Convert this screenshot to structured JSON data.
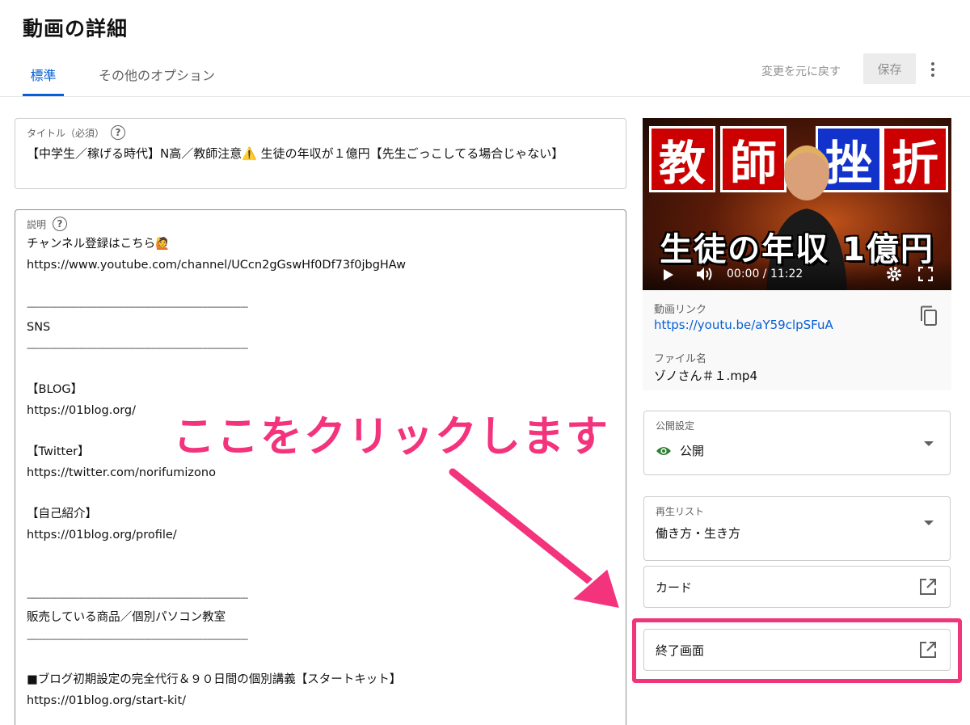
{
  "page": {
    "title": "動画の詳細"
  },
  "tabs": [
    {
      "label": "標準",
      "active": true
    },
    {
      "label": "その他のオプション",
      "active": false
    }
  ],
  "toolbar": {
    "undo_label": "変更を元に戻す",
    "save_label": "保存",
    "more_icon": "more-vert-icon"
  },
  "title_field": {
    "label": "タイトル（必須）",
    "value": "【中学生／稼げる時代】N高／教師注意⚠️ 生徒の年収が１億円【先生ごっこしてる場合じゃない】"
  },
  "description_field": {
    "label": "説明",
    "lines": [
      "チャンネル登録はこちら🙋",
      "https://www.youtube.com/channel/UCcn2gGswHf0Df73f0jbgHAw",
      "",
      "--------------------------------------------------------------------------------------------",
      "SNS",
      "--------------------------------------------------------------------------------------------",
      "",
      "【BLOG】",
      "https://01blog.org/",
      "",
      "【Twitter】",
      "https://twitter.com/norifumizono",
      "",
      "【自己紹介】",
      "https://01blog.org/profile/",
      "",
      "",
      "--------------------------------------------------------------------------------------------",
      "販売している商品／個別パソコン教室",
      "--------------------------------------------------------------------------------------------",
      "",
      "■ブログ初期設定の完全代行＆９０日間の個別講義【スタートキット】",
      "https://01blog.org/start-kit/"
    ]
  },
  "video": {
    "thumbnail_top_text": [
      "教",
      "師",
      "挫",
      "折"
    ],
    "thumbnail_bottom_text": "生徒の年収 1億円",
    "time": "00:00 / 11:22",
    "link_label": "動画リンク",
    "link_value": "https://youtu.be/aY59clpSFuA",
    "file_label": "ファイル名",
    "file_value": "ゾノさん＃１.mp4"
  },
  "visibility": {
    "label": "公開設定",
    "value": "公開",
    "accent": "#2e7d32"
  },
  "playlist": {
    "label": "再生リスト",
    "value": "働き方・生き方"
  },
  "cards": {
    "label": "カード"
  },
  "end_screen": {
    "label": "終了画面"
  },
  "annotation": {
    "text": "ここをクリックします",
    "color": "#f3337c"
  }
}
